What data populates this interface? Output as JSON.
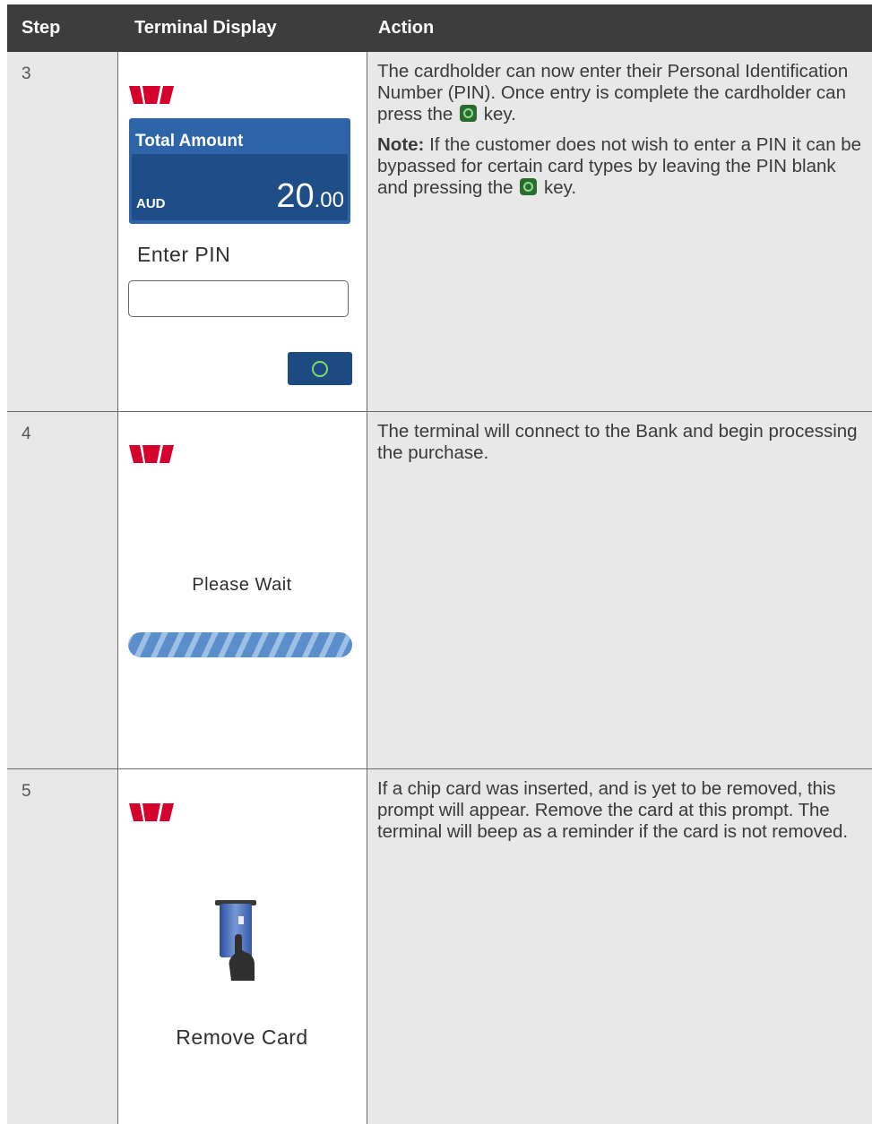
{
  "header": {
    "col_step": "Step",
    "col_display": "Terminal Display",
    "col_action": "Action"
  },
  "rows": [
    {
      "step": "3",
      "display": {
        "amount_title": "Total Amount",
        "currency": "AUD",
        "amount_main": "20",
        "amount_cents": ".00",
        "prompt": "Enter PIN"
      },
      "action": {
        "p1_before": "The cardholder can now enter their Personal Identification Number (PIN). Once entry is complete the cardholder can press the",
        "p1_after": " key.",
        "note_label": "Note:",
        "p2_before": " If the customer does not wish to enter a PIN it can be bypassed for certain card types by leaving the PIN blank and pressing the",
        "p2_after": " key."
      }
    },
    {
      "step": "4",
      "display": {
        "prompt": "Please Wait"
      },
      "action": {
        "text": "The terminal will connect to the Bank and begin processing the purchase."
      }
    },
    {
      "step": "5",
      "display": {
        "prompt": "Remove Card"
      },
      "action": {
        "text": "If a chip card was inserted, and is yet to be removed, this prompt will appear. Remove the card at this prompt. The terminal will beep as a reminder if the card is not removed."
      }
    }
  ],
  "colors": {
    "brand_red": "#d5002b",
    "header_bg": "#3d3d3d",
    "panel_blue": "#2d65a8",
    "ok_green": "#7bdc6f"
  }
}
